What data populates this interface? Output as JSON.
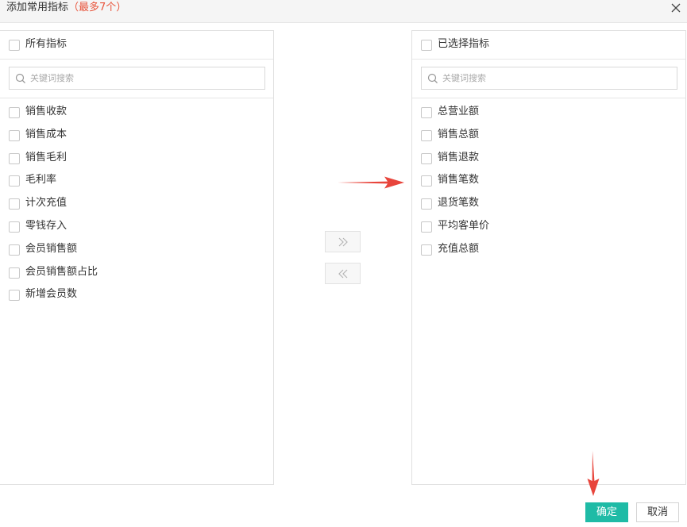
{
  "dialog": {
    "title": "添加常用指标",
    "title_limit": "（最多7个）",
    "close_icon": "close-icon"
  },
  "left_panel": {
    "header_label": "所有指标",
    "search_placeholder": "关键词搜索",
    "items": [
      {
        "label": "销售收款"
      },
      {
        "label": "销售成本"
      },
      {
        "label": "销售毛利"
      },
      {
        "label": "毛利率"
      },
      {
        "label": "计次充值"
      },
      {
        "label": "零钱存入"
      },
      {
        "label": "会员销售额"
      },
      {
        "label": "会员销售额占比"
      },
      {
        "label": "新增会员数"
      }
    ]
  },
  "right_panel": {
    "header_label": "已选择指标",
    "search_placeholder": "关键词搜索",
    "items": [
      {
        "label": "总营业额"
      },
      {
        "label": "销售总额"
      },
      {
        "label": "销售退款"
      },
      {
        "label": "销售笔数"
      },
      {
        "label": "退货笔数"
      },
      {
        "label": "平均客单价"
      },
      {
        "label": "充值总额"
      }
    ]
  },
  "transfer": {
    "move_right_icon": "double-chevron-right-icon",
    "move_left_icon": "double-chevron-left-icon"
  },
  "footer": {
    "confirm_label": "确定",
    "cancel_label": "取消"
  },
  "colors": {
    "confirm_bg": "#1fbba6",
    "limit_text": "#e8543b",
    "annotation_arrow": "#e8453c",
    "header_bg": "#f5f5f5"
  }
}
